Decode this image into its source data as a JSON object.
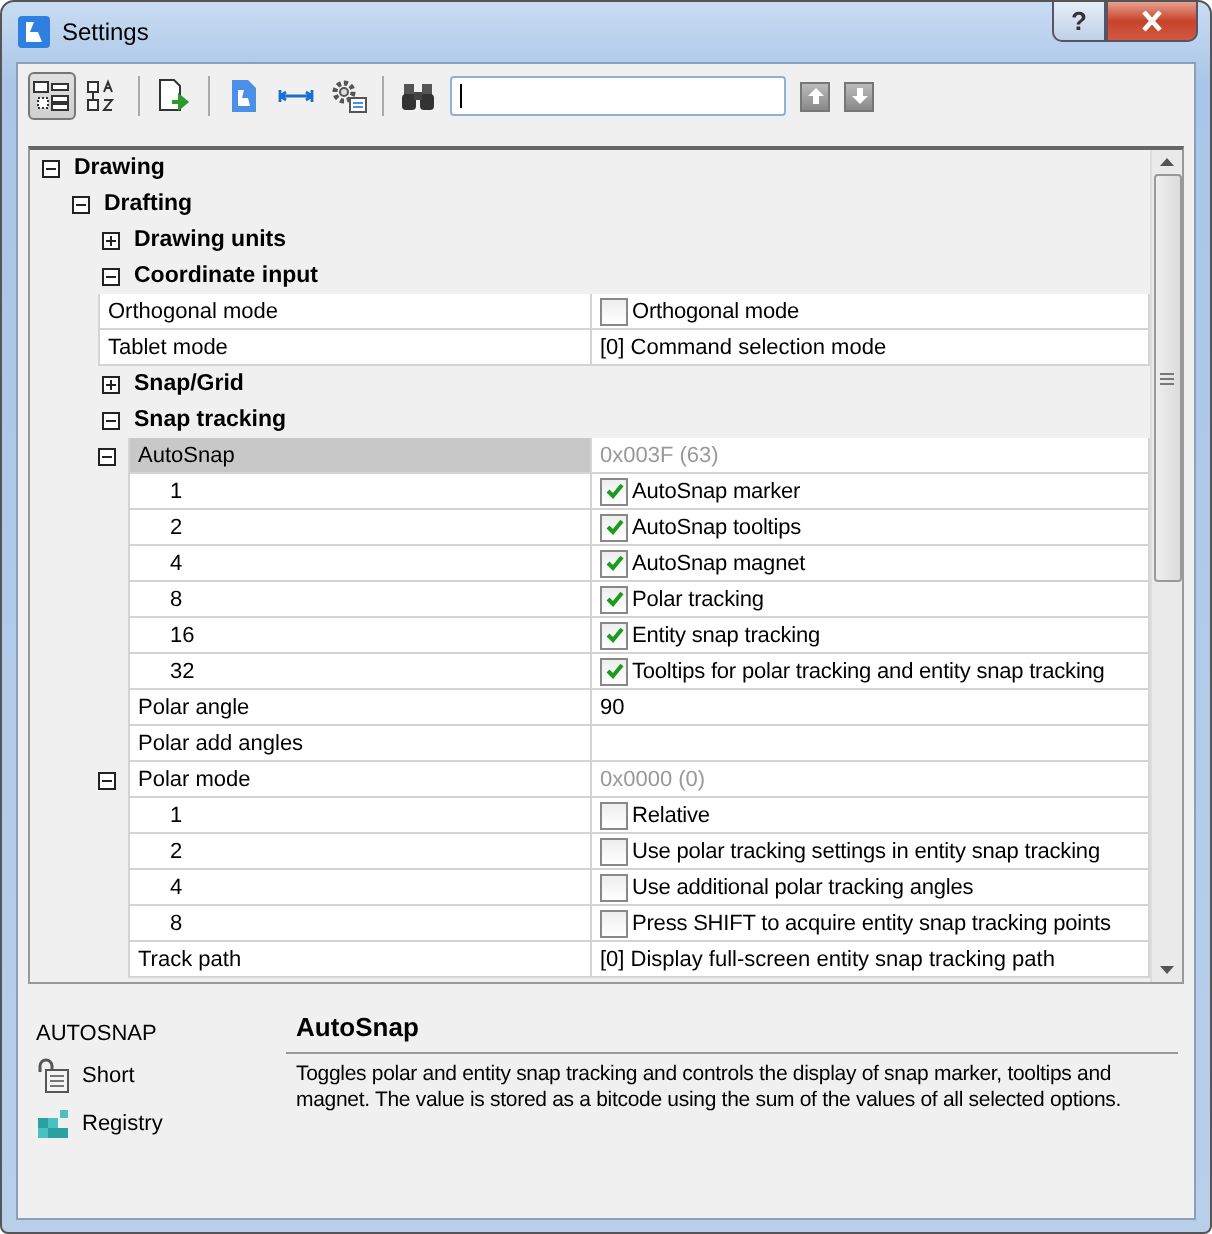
{
  "window": {
    "title": "Settings",
    "help": "?"
  },
  "toolbar": {
    "view_modes": [
      {
        "selected": true
      },
      {
        "selected": false
      }
    ]
  },
  "tree": [
    {
      "kind": "group",
      "name": "Drawing",
      "expanded": true,
      "children": [
        {
          "kind": "group",
          "name": "Drafting",
          "expanded": true,
          "children": [
            {
              "kind": "group",
              "name": "Drawing units",
              "expanded": false
            },
            {
              "kind": "group",
              "name": "Coordinate input",
              "expanded": true,
              "children": [
                {
                  "kind": "check",
                  "name": "Orthogonal mode",
                  "selected": false,
                  "checked": false,
                  "value": "Orthogonal mode"
                },
                {
                  "kind": "setting",
                  "name": "Tablet mode",
                  "selected": false,
                  "value": "[0] Command selection mode"
                }
              ]
            },
            {
              "kind": "group",
              "name": "Snap/Grid",
              "expanded": false
            },
            {
              "kind": "group",
              "name": "Snap tracking",
              "expanded": true,
              "children": [
                {
                  "kind": "bitmask",
                  "name": "AutoSnap",
                  "selected": true,
                  "expanded": true,
                  "value": "0x003F (63)",
                  "children": [
                    {
                      "kind": "flag",
                      "name": "1",
                      "selected": false,
                      "checked": true,
                      "value": "AutoSnap marker"
                    },
                    {
                      "kind": "flag",
                      "name": "2",
                      "selected": false,
                      "checked": true,
                      "value": "AutoSnap tooltips"
                    },
                    {
                      "kind": "flag",
                      "name": "4",
                      "selected": false,
                      "checked": true,
                      "value": "AutoSnap magnet"
                    },
                    {
                      "kind": "flag",
                      "name": "8",
                      "selected": false,
                      "checked": true,
                      "value": "Polar tracking"
                    },
                    {
                      "kind": "flag",
                      "name": "16",
                      "selected": false,
                      "checked": true,
                      "value": "Entity snap tracking"
                    },
                    {
                      "kind": "flag",
                      "name": "32",
                      "selected": false,
                      "checked": true,
                      "value": "Tooltips for polar tracking and entity snap tracking"
                    }
                  ]
                },
                {
                  "kind": "setting",
                  "name": "Polar angle",
                  "selected": false,
                  "value": "90"
                },
                {
                  "kind": "setting",
                  "name": "Polar add angles",
                  "selected": false
                },
                {
                  "kind": "bitmask",
                  "name": "Polar mode",
                  "selected": false,
                  "expanded": true,
                  "value": "0x0000 (0)",
                  "children": [
                    {
                      "kind": "flag",
                      "name": "1",
                      "selected": false,
                      "checked": false,
                      "value": "Relative"
                    },
                    {
                      "kind": "flag",
                      "name": "2",
                      "selected": false,
                      "checked": false,
                      "value": "Use polar tracking settings in entity snap tracking"
                    },
                    {
                      "kind": "flag",
                      "name": "4",
                      "selected": false,
                      "checked": false,
                      "value": "Use additional polar tracking angles"
                    },
                    {
                      "kind": "flag",
                      "name": "8",
                      "selected": false,
                      "checked": false,
                      "value": "Press SHIFT to acquire entity snap tracking points"
                    }
                  ]
                },
                {
                  "kind": "setting",
                  "name": "Track path",
                  "selected": false,
                  "value": "[0] Display full-screen entity snap tracking path"
                }
              ]
            }
          ]
        }
      ]
    }
  ],
  "help_panel": {
    "variable": "AUTOSNAP",
    "links": [
      "Short",
      "Registry"
    ],
    "title": "AutoSnap",
    "description": "Toggles polar and entity snap tracking and controls the display of snap marker, tooltips and magnet. The value is stored as a bitcode using the sum of the values of all selected options."
  }
}
